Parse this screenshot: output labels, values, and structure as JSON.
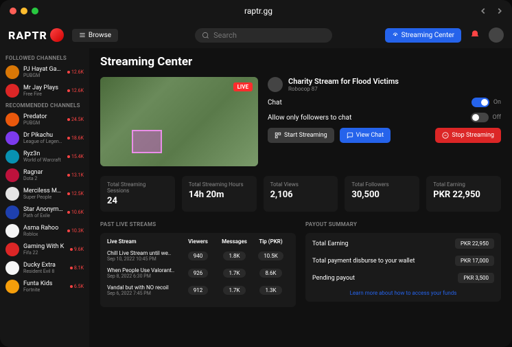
{
  "url": "raptr.gg",
  "logo": "RAPTR",
  "browse": "Browse",
  "search_placeholder": "Search",
  "streaming_center_btn": "Streaming Center",
  "sidebar": {
    "followed_hdr": "FOLLOWED CHANNELS",
    "recommended_hdr": "RECOMMENDED CHANNELS",
    "followed": [
      {
        "name": "PJ Hayat Gaming",
        "game": "PUBGM",
        "viewers": "12.6K",
        "color": "#d97706"
      },
      {
        "name": "Mr Jay Plays",
        "game": "Free Fire",
        "viewers": "12.6K",
        "color": "#dc2626"
      }
    ],
    "recommended": [
      {
        "name": "Predator",
        "game": "PUBGM",
        "viewers": "24.5K",
        "color": "#ea580c"
      },
      {
        "name": "Dr Pikachu",
        "game": "League of Legends",
        "viewers": "18.6K",
        "color": "#7c3aed"
      },
      {
        "name": "Ryz3n",
        "game": "World of Warcraft",
        "viewers": "15.4K",
        "color": "#0891b2"
      },
      {
        "name": "Ragnar",
        "game": "Dota 2",
        "viewers": "13.1K",
        "color": "#be123c"
      },
      {
        "name": "Merciless Medic",
        "game": "Super People",
        "viewers": "12.5K",
        "color": "#e5e5e5"
      },
      {
        "name": "Star Anonymous",
        "game": "Path of Exile",
        "viewers": "10.6K",
        "color": "#1e40af"
      },
      {
        "name": "Asma Rahoo",
        "game": "Roblox",
        "viewers": "10.3K",
        "color": "#f5f5f5"
      },
      {
        "name": "Gaming With K",
        "game": "Fifa 22",
        "viewers": "9.6K",
        "color": "#dc2626"
      },
      {
        "name": "Ducky Extra",
        "game": "Resident Evil 8",
        "viewers": "8.1K",
        "color": "#f5f5f5"
      },
      {
        "name": "Funta Kids",
        "game": "Fortnite",
        "viewers": "6.5K",
        "color": "#f59e0b"
      }
    ]
  },
  "page_title": "Streaming Center",
  "live_badge": "LIVE",
  "stream": {
    "title": "Charity Stream for Flood Victims",
    "user": "Robocop 87"
  },
  "ctrls": {
    "chat": "Chat",
    "chat_on": "On",
    "followers": "Allow only followers to chat",
    "followers_off": "Off",
    "start": "Start Streaming",
    "view": "View Chat",
    "stop": "Stop Streaming"
  },
  "stats": [
    {
      "label": "Total Streaming Sessions",
      "value": "24"
    },
    {
      "label": "Total Streaming Hours",
      "value": "14h 20m"
    },
    {
      "label": "Total Views",
      "value": "2,106"
    },
    {
      "label": "Total Followers",
      "value": "30,500"
    },
    {
      "label": "Total Earning",
      "value": "PKR 22,950"
    }
  ],
  "past_hdr": "PAST LIVE STREAMS",
  "payout_hdr": "PAYOUT SUMMARY",
  "table": {
    "hdrs": {
      "c1": "Live Stream",
      "c2": "Viewers",
      "c3": "Messages",
      "c4": "Tip (PKR)"
    },
    "rows": [
      {
        "name": "Chill Live Stream until we..",
        "date": "Sep 10, 2022 10:45 PM",
        "viewers": "940",
        "messages": "1.8K",
        "tip": "10.5K"
      },
      {
        "name": "When People Use Valorant..",
        "date": "Sep 8, 2022 6:30 PM",
        "viewers": "926",
        "messages": "1.7K",
        "tip": "8.6K"
      },
      {
        "name": "Vandal but with NO recoil",
        "date": "Sep 6, 2022 7:45 PM",
        "viewers": "912",
        "messages": "1.7K",
        "tip": "1.3K"
      }
    ]
  },
  "payout": {
    "rows": [
      {
        "label": "Total Earning",
        "value": "PKR 22,950"
      },
      {
        "label": "Total payment disburse to your wallet",
        "value": "PKR 17,000"
      },
      {
        "label": "Pending payout",
        "value": "PKR 3,500"
      }
    ],
    "link": "Learn more about how to access your funds"
  }
}
